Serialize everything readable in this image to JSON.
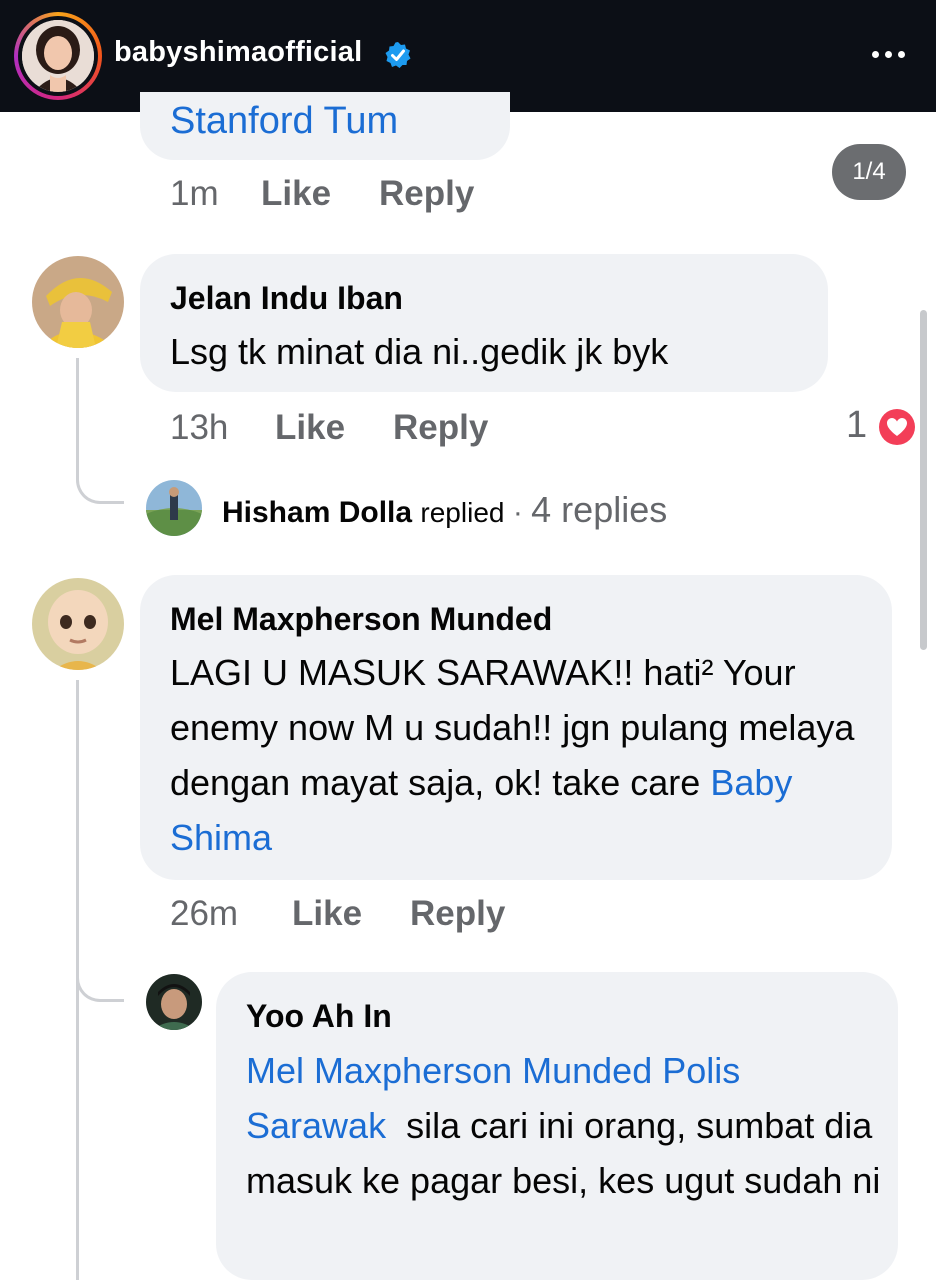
{
  "header": {
    "username": "babyshimaofficial",
    "verified_icon": "verified-badge-icon",
    "more_icon": "more-dots-icon"
  },
  "colors": {
    "header_bg": "#0c0f16",
    "bubble_bg": "#f0f2f5",
    "link": "#1b6dd4",
    "meta": "#65676b",
    "heart": "#f33e58"
  },
  "top_comment": {
    "text": "Stanford Tum",
    "time": "1m",
    "like": "Like",
    "reply": "Reply",
    "pager": "1/4"
  },
  "comment1": {
    "author": "Jelan Indu Iban",
    "text": "Lsg tk minat dia ni..gedik jk byk",
    "time": "13h",
    "like": "Like",
    "reply": "Reply",
    "reaction_count": "1",
    "reaction_icon": "love-heart-icon",
    "replies_summary": {
      "name": "Hisham Dolla",
      "action": "replied",
      "separator": "·",
      "count": "4 replies"
    }
  },
  "comment2": {
    "author": "Mel Maxpherson Munded",
    "text": "LAGI U MASUK SARAWAK!! hati² Your enemy now M u sudah!! jgn pulang melaya dengan mayat saja, ok! take care ",
    "mention": "Baby Shima",
    "time": "26m",
    "like": "Like",
    "reply": "Reply"
  },
  "reply1": {
    "author": "Yoo Ah In",
    "mention": "Mel Maxpherson Munded Polis Sarawak",
    "text": "  sila cari ini orang, sumbat dia masuk ke pagar besi, kes ugut sudah ni"
  }
}
